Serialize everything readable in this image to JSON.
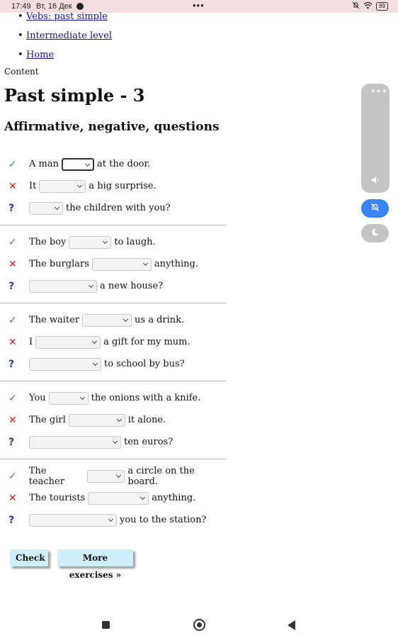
{
  "status_bar": {
    "time": "17:49",
    "date": "Вт, 16 Дек",
    "center_dots": "•••",
    "battery": "89"
  },
  "nav": {
    "items": [
      "Vebs: past simple",
      "Intermediate level",
      "Home"
    ]
  },
  "content_label": "Content",
  "page_title": "Past simple - 3",
  "subtitle": "Affirmative, negative, questions",
  "exercise": {
    "groups": [
      {
        "rows": [
          {
            "type": "aff",
            "before": "A man",
            "after": "at the door."
          },
          {
            "type": "neg",
            "before": "It",
            "after": "a big surprise."
          },
          {
            "type": "q",
            "before": "",
            "after": "the children with you?"
          }
        ]
      },
      {
        "rows": [
          {
            "type": "aff",
            "before": "The boy",
            "after": "to laugh."
          },
          {
            "type": "neg",
            "before": "The burglars",
            "after": "anything."
          },
          {
            "type": "q",
            "before": "",
            "after": "a new house?"
          }
        ]
      },
      {
        "rows": [
          {
            "type": "aff",
            "before": "The waiter",
            "after": "us a drink."
          },
          {
            "type": "neg",
            "before": "I",
            "after": "a gift for my mum."
          },
          {
            "type": "q",
            "before": "",
            "after": "to school by bus?"
          }
        ]
      },
      {
        "rows": [
          {
            "type": "aff",
            "before": "You",
            "after": "the onions with a knife."
          },
          {
            "type": "neg",
            "before": "The girl",
            "after": "it alone."
          },
          {
            "type": "q",
            "before": "",
            "after": "ten euros?"
          }
        ]
      },
      {
        "rows": [
          {
            "type": "aff",
            "before": "The teacher",
            "after": "a circle on the board."
          },
          {
            "type": "neg",
            "before": "The tourists",
            "after": "anything."
          },
          {
            "type": "q",
            "before": "",
            "after": "you to the station?"
          }
        ]
      }
    ]
  },
  "marks": {
    "aff": "✓",
    "neg": "✕",
    "q": "?"
  },
  "buttons": {
    "check": "Check",
    "more": "More exercises »"
  },
  "floating_panel": {
    "dots": "•••",
    "volume_icon": "speaker-icon",
    "mute_icon": "bell-off-icon",
    "moon_icon": "moon-icon"
  },
  "colors": {
    "affirmative": "#2e9e2e",
    "negative": "#d92020",
    "question": "#2a3a8c",
    "button_bg": "#cfeefc",
    "link": "#1a0dab"
  }
}
